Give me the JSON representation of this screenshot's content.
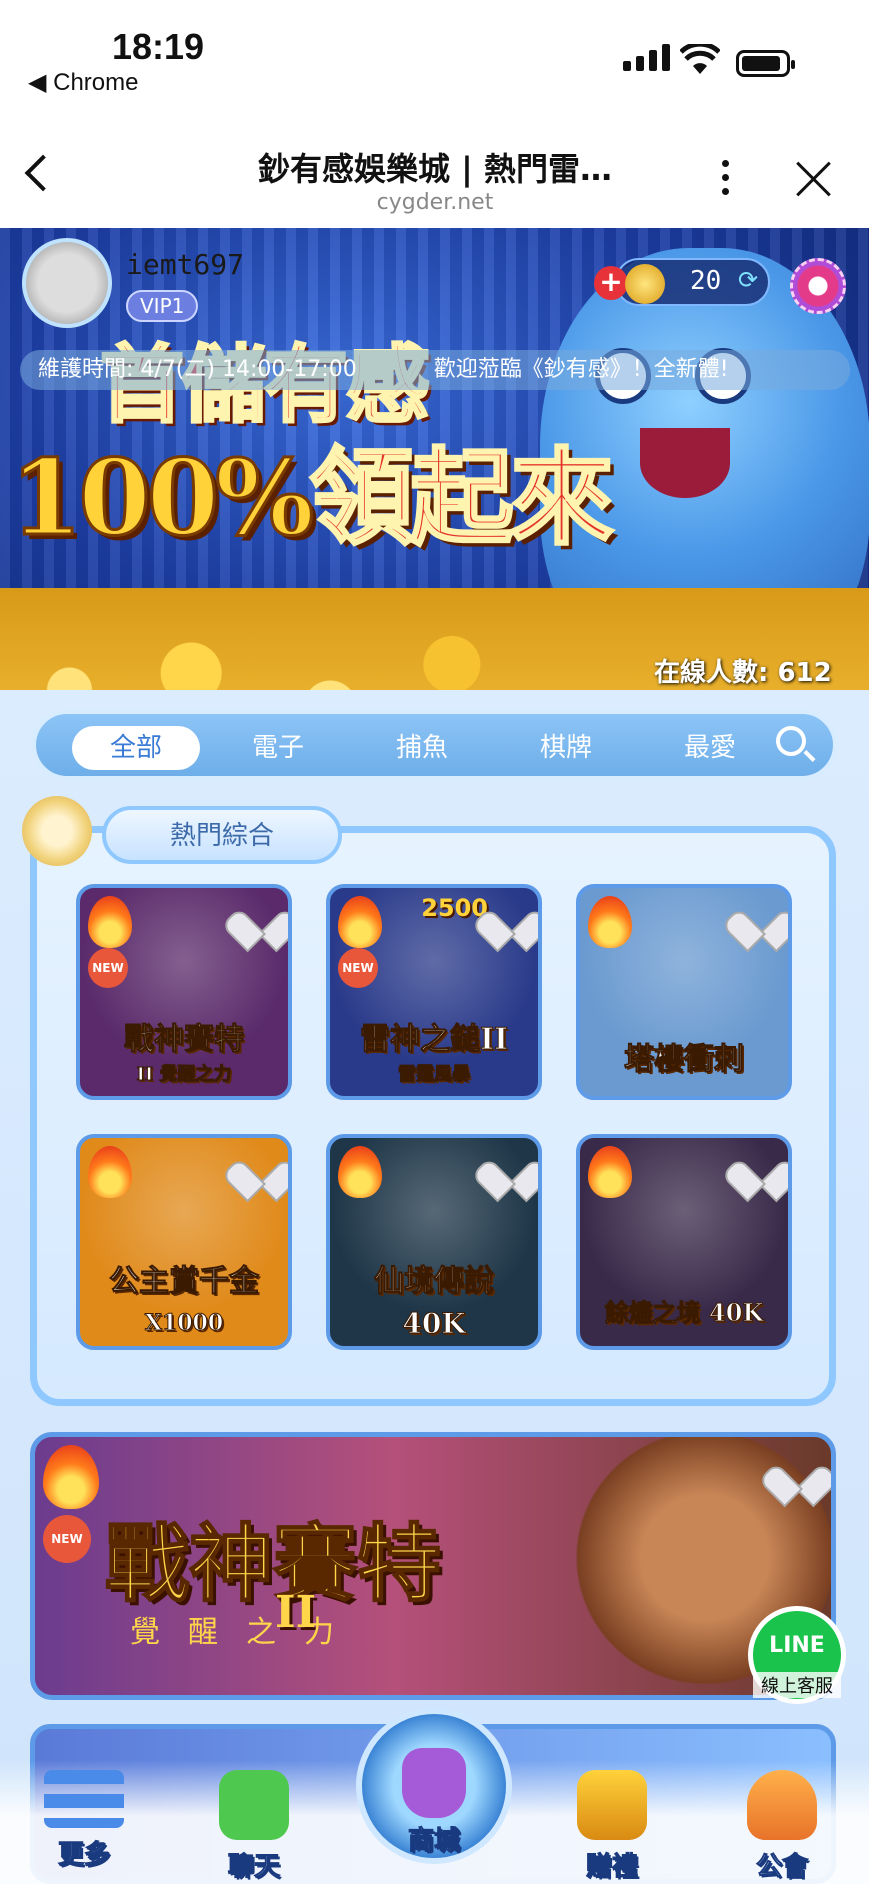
{
  "status_bar": {
    "time": "18:19",
    "back_app": "◀ Chrome"
  },
  "browser": {
    "title": "鈔有感娛樂城 | 熱門雷…",
    "url": "cygder.net"
  },
  "user": {
    "name": "iemt697",
    "vip": "VIP1",
    "coins": "20"
  },
  "marquee": {
    "maintenance": "維護時間: 4/7(二) 14:00-17:00",
    "welcome": "歡迎蒞臨《鈔有感》！全新體!"
  },
  "promo": {
    "line1": "首儲有感",
    "line2_gold": "100%",
    "line2_red": "領起來"
  },
  "online": "在線人數: 612",
  "tabs": [
    "全部",
    "電子",
    "捕魚",
    "棋牌",
    "最愛"
  ],
  "section_title": "熱門綜合",
  "games": [
    {
      "title": "戰神賽特",
      "subtitle": "II 覺醒之力",
      "badge": "NEW",
      "bg": "#5a2a6a"
    },
    {
      "title": "雷神之鎚II",
      "subtitle": "雷霆風暴",
      "badge": "NEW",
      "extra": "2500",
      "bg": "#2a3a8a"
    },
    {
      "title": "塔樓衝刺",
      "subtitle": "",
      "badge": "",
      "bg": "#6a9ad0"
    },
    {
      "title": "公主賞千金",
      "subtitle": "X1000",
      "badge": "",
      "bg": "#e08a1a"
    },
    {
      "title": "仙境傳說",
      "subtitle": "40K",
      "badge": "",
      "bg": "#1e3648"
    },
    {
      "title": "餘燼之境 40K",
      "subtitle": "",
      "badge": "",
      "bg": "#3a2a4a"
    }
  ],
  "banner": {
    "title": "戰神賽特",
    "numeral": "II",
    "subtitle": "覺醒之力",
    "badge": "NEW"
  },
  "line_chat": {
    "brand": "LINE",
    "label": "線上客服"
  },
  "bottom_nav": {
    "more": "更多",
    "chat": "聊天",
    "shop": "商城",
    "gift": "贈禮",
    "guild": "公會"
  }
}
